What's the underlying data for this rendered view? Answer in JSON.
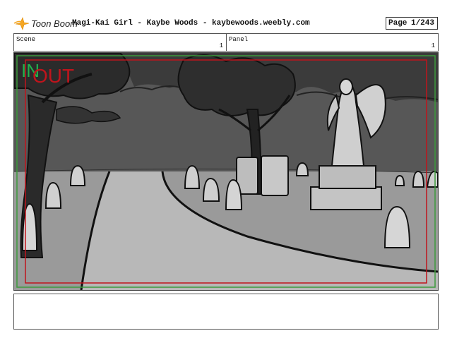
{
  "header": {
    "logo_text": "Toon Boom",
    "title": "Magi-Kai Girl - Kaybe Woods - kaybewoods.weebly.com",
    "page_label": "Page",
    "page_number": "1/243"
  },
  "info": {
    "scene_label": "Scene",
    "scene_value": "1",
    "panel_label": "Panel",
    "panel_value": "1"
  },
  "panel": {
    "in_marker": "IN",
    "out_marker": "OUT",
    "in_color": "#22b14c",
    "out_color": "#c0141c"
  },
  "notes": {
    "text": ""
  }
}
